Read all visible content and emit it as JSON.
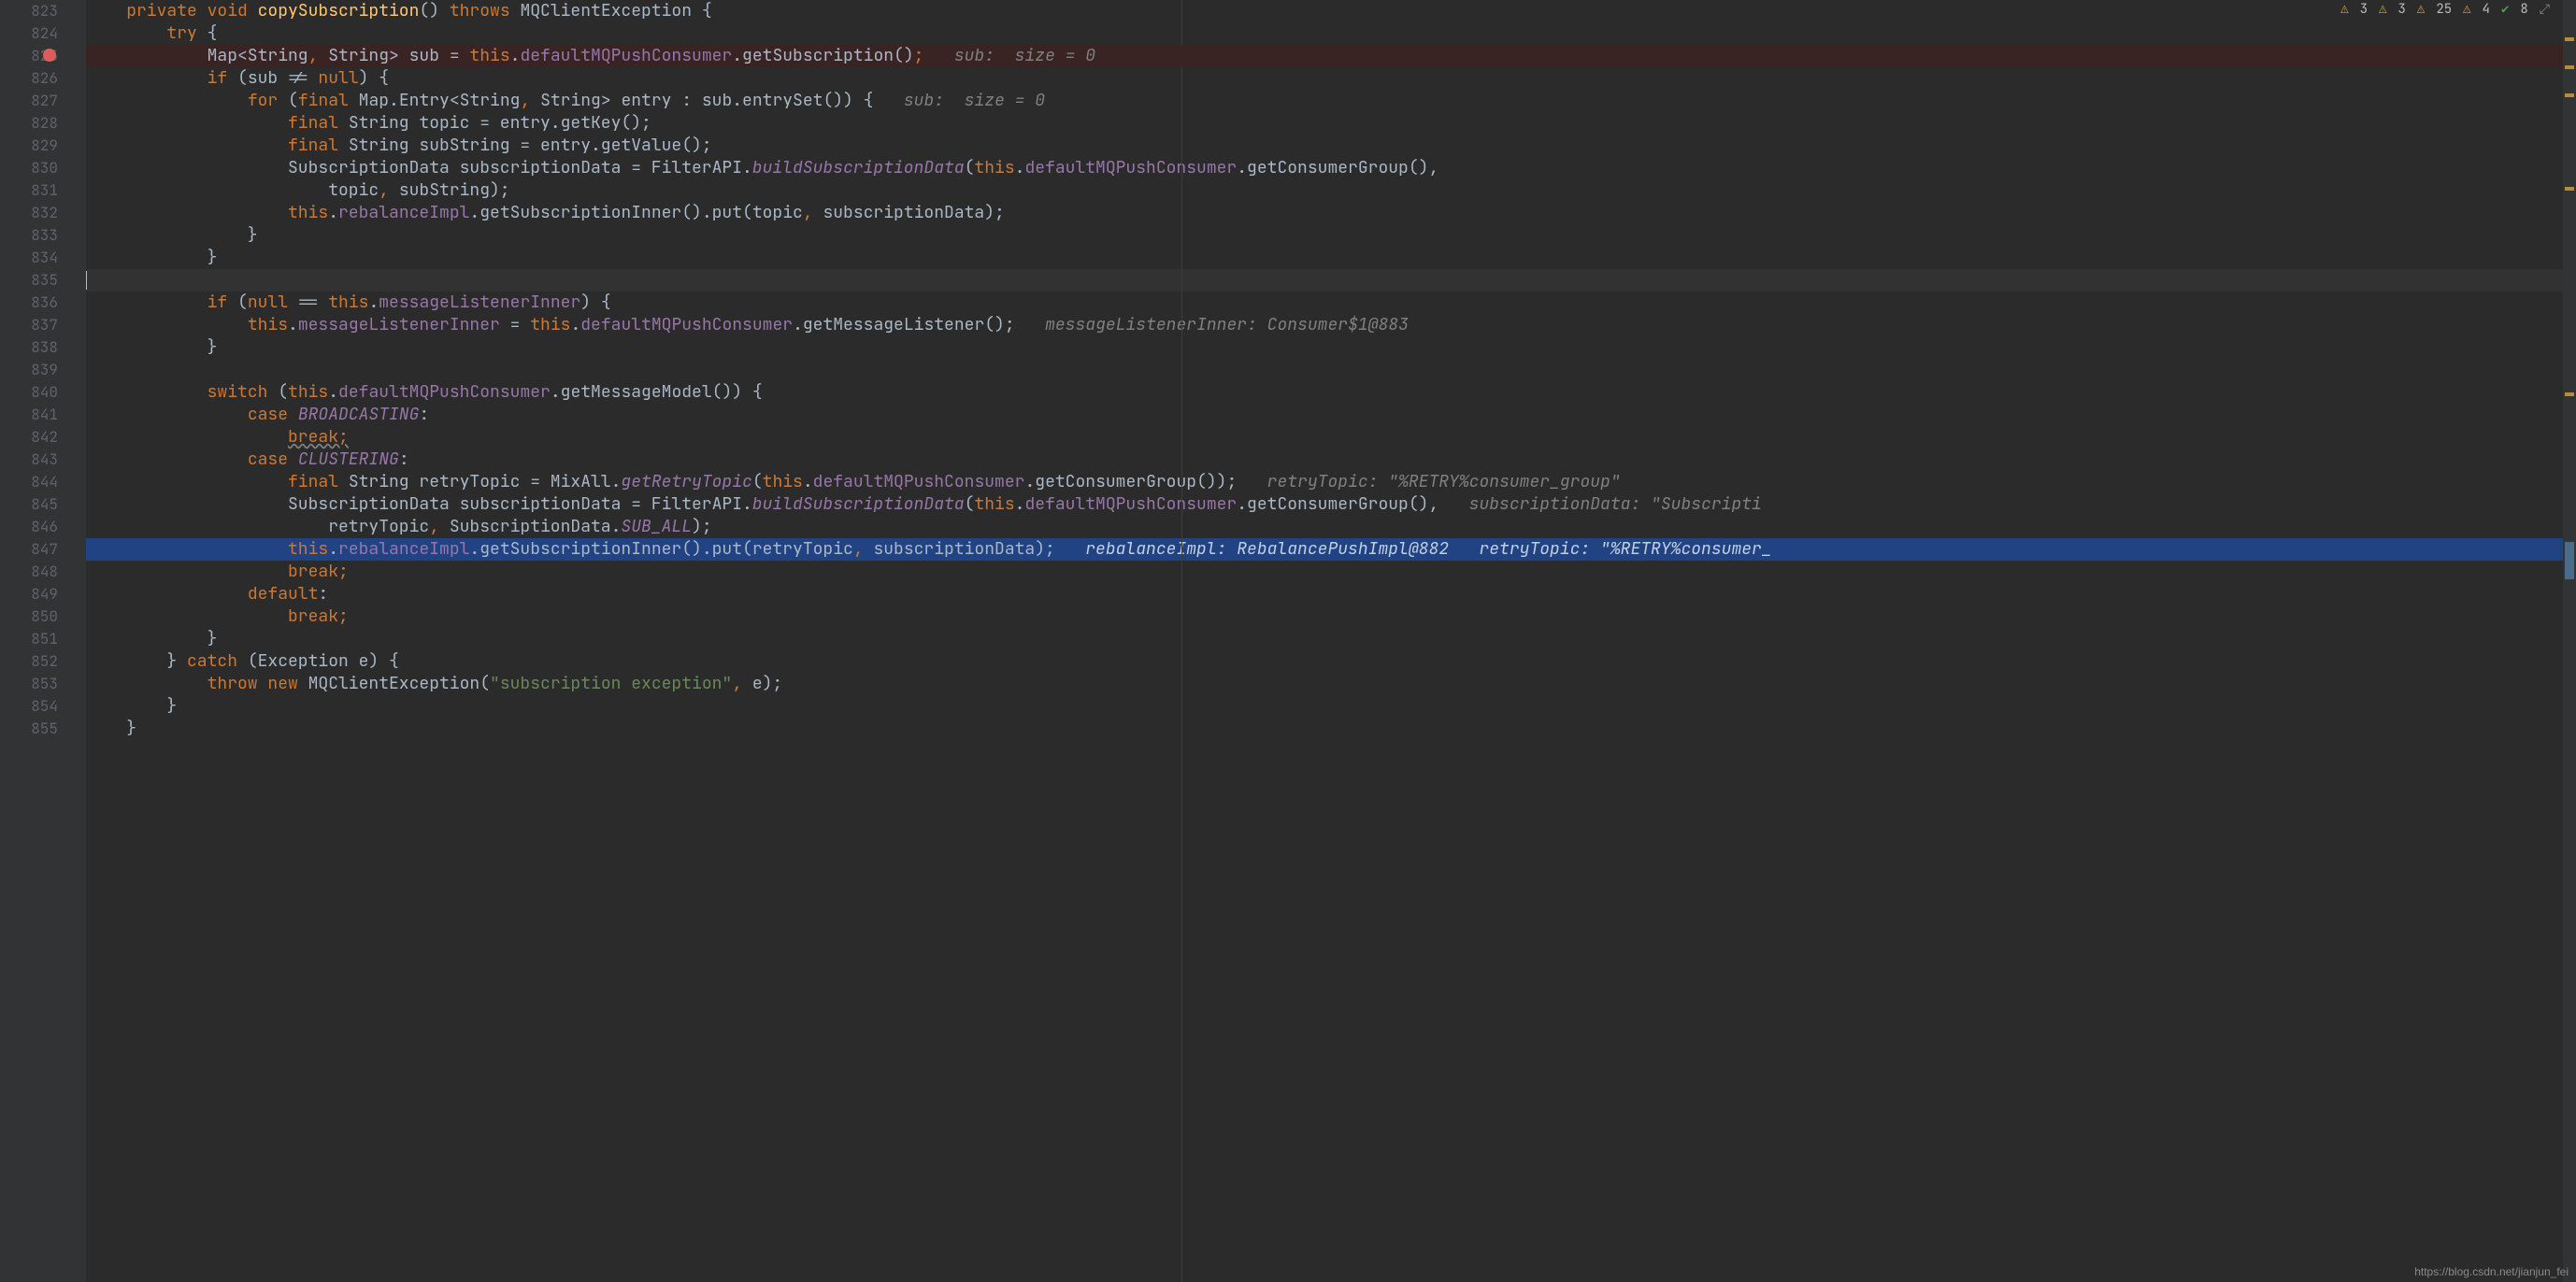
{
  "watermark": "https://blog.csdn.net/jianjun_fei",
  "topbar": {
    "w1": "3",
    "w2": "3",
    "w3": "25",
    "w4": "4",
    "ok": "8"
  },
  "lines": [
    {
      "no": "823"
    },
    {
      "no": "824"
    },
    {
      "no": "825"
    },
    {
      "no": "826"
    },
    {
      "no": "827"
    },
    {
      "no": "828"
    },
    {
      "no": "829"
    },
    {
      "no": "830"
    },
    {
      "no": "831"
    },
    {
      "no": "832"
    },
    {
      "no": "833"
    },
    {
      "no": "834"
    },
    {
      "no": "835"
    },
    {
      "no": "836"
    },
    {
      "no": "837"
    },
    {
      "no": "838"
    },
    {
      "no": "839"
    },
    {
      "no": "840"
    },
    {
      "no": "841"
    },
    {
      "no": "842"
    },
    {
      "no": "843"
    },
    {
      "no": "844"
    },
    {
      "no": "845"
    },
    {
      "no": "846"
    },
    {
      "no": "847"
    },
    {
      "no": "848"
    },
    {
      "no": "849"
    },
    {
      "no": "850"
    },
    {
      "no": "851"
    },
    {
      "no": "852"
    },
    {
      "no": "853"
    },
    {
      "no": "854"
    },
    {
      "no": "855"
    }
  ],
  "code": {
    "l823": {
      "pre": "    ",
      "kw1": "private void ",
      "mth": "copySubscription",
      "p1": "() ",
      "kw2": "throws ",
      "exc": "MQClientException {"
    },
    "l824": {
      "pre": "        ",
      "kw": "try ",
      "b": "{"
    },
    "l825": {
      "pre": "            Map<String",
      "c1": ", ",
      "g": "String> sub = ",
      "kw": "this",
      "d": ".",
      "f": "defaultMQPushConsumer",
      "d2": ".getSubscription()",
      "sc": ";",
      "hint": "   sub:  size = 0"
    },
    "l826": {
      "pre": "            ",
      "kw": "if ",
      "p": "(sub != ",
      "nul": "null",
      "r": ") {"
    },
    "l827": {
      "pre": "                ",
      "kw": "for ",
      "p": "(",
      "fn": "final ",
      "t": "Map.Entry<String",
      "c": ", ",
      "t2": "String> entry : sub.entrySet()) {",
      "hint": "   sub:  size = 0"
    },
    "l828": {
      "pre": "                    ",
      "fn": "final ",
      "t": "String topic = entry.getKey();"
    },
    "l829": {
      "pre": "                    ",
      "fn": "final ",
      "t": "String subString = entry.getValue();"
    },
    "l830": {
      "pre": "                    SubscriptionData subscriptionData = FilterAPI.",
      "it": "buildSubscriptionData",
      "p": "(",
      "kw": "this",
      "d": ".",
      "f": "defaultMQPushConsumer",
      "r": ".getConsumerGroup(),"
    },
    "l831": {
      "pre": "                        topic",
      ",": ", ",
      "r": "subString);"
    },
    "l832": {
      "pre": "                    ",
      "kw": "this",
      "d": ".",
      "f": "rebalanceImpl",
      "r": ".getSubscriptionInner().put(topic",
      ",": ", ",
      "r2": "subscriptionData);"
    },
    "l833": {
      "pre": "                }"
    },
    "l834": {
      "pre": "            }"
    },
    "l835": {
      "pre": ""
    },
    "l836": {
      "pre": "            ",
      "kw": "if ",
      "p": "(",
      "nul": "null ",
      "eq": "== ",
      "kw2": "this",
      "d": ".",
      "f": "messageListenerInner",
      "r": ") {"
    },
    "l837": {
      "pre": "                ",
      "kw": "this",
      "d": ".",
      "f": "messageListenerInner",
      "eq": " = ",
      "kw2": "this",
      "d2": ".",
      "f2": "defaultMQPushConsumer",
      "r": ".getMessageListener();",
      "hint": "   messageListenerInner: Consumer$1@883"
    },
    "l838": {
      "pre": "            }"
    },
    "l839": {
      "pre": ""
    },
    "l840": {
      "pre": "            ",
      "kw": "switch ",
      "p": "(",
      "kw2": "this",
      "d": ".",
      "f": "defaultMQPushConsumer",
      "r": ".getMessageModel()) {"
    },
    "l841": {
      "pre": "                ",
      "kw": "case ",
      "en": "BROADCASTING",
      "c": ":"
    },
    "l842": {
      "pre": "                    ",
      "kw": "break;"
    },
    "l843": {
      "pre": "                ",
      "kw": "case ",
      "en": "CLUSTERING",
      "c": ":"
    },
    "l844": {
      "pre": "                    ",
      "fn": "final ",
      "t": "String retryTopic = MixAll.",
      "it": "getRetryTopic",
      "p": "(",
      "kw": "this",
      "d": ".",
      "f": "defaultMQPushConsumer",
      "r": ".getConsumerGroup());",
      "hint": "   retryTopic: \"%RETRY%consumer_group\""
    },
    "l845": {
      "pre": "                    SubscriptionData subscriptionData = FilterAPI.",
      "it": "buildSubscriptionData",
      "p": "(",
      "kw": "this",
      "d": ".",
      "f": "defaultMQPushConsumer",
      "r": ".getConsumerGroup(),",
      "hint": "   subscriptionData: \"Subscripti"
    },
    "l846": {
      "pre": "                        retryTopic",
      ",": ", ",
      "t": "SubscriptionData.",
      "cn": "SUB_ALL",
      "r": ");"
    },
    "l847": {
      "pre": "                    ",
      "kw": "this",
      "d": ".",
      "f": "rebalanceImpl",
      "r": ".getSubscriptionInner().put(retryTopic",
      ",": ", ",
      "r2": "subscriptionData);",
      "hint": "   rebalanceImpl: RebalancePushImpl@882   retryTopic: \"%RETRY%consumer_"
    },
    "l848": {
      "pre": "                    ",
      "kw": "break;"
    },
    "l849": {
      "pre": "                ",
      "kw": "default",
      ":": ":"
    },
    "l850": {
      "pre": "                    ",
      "kw": "break;"
    },
    "l851": {
      "pre": "            }"
    },
    "l852": {
      "pre": "        } ",
      "kw": "catch ",
      "p": "(Exception e) {"
    },
    "l853": {
      "pre": "            ",
      "kw": "throw new ",
      "t": "MQClientException(",
      "s": "\"subscription exception\"",
      ",": ", ",
      "r": "e);"
    },
    "l854": {
      "pre": "        }"
    },
    "l855": {
      "pre": "    }"
    }
  }
}
